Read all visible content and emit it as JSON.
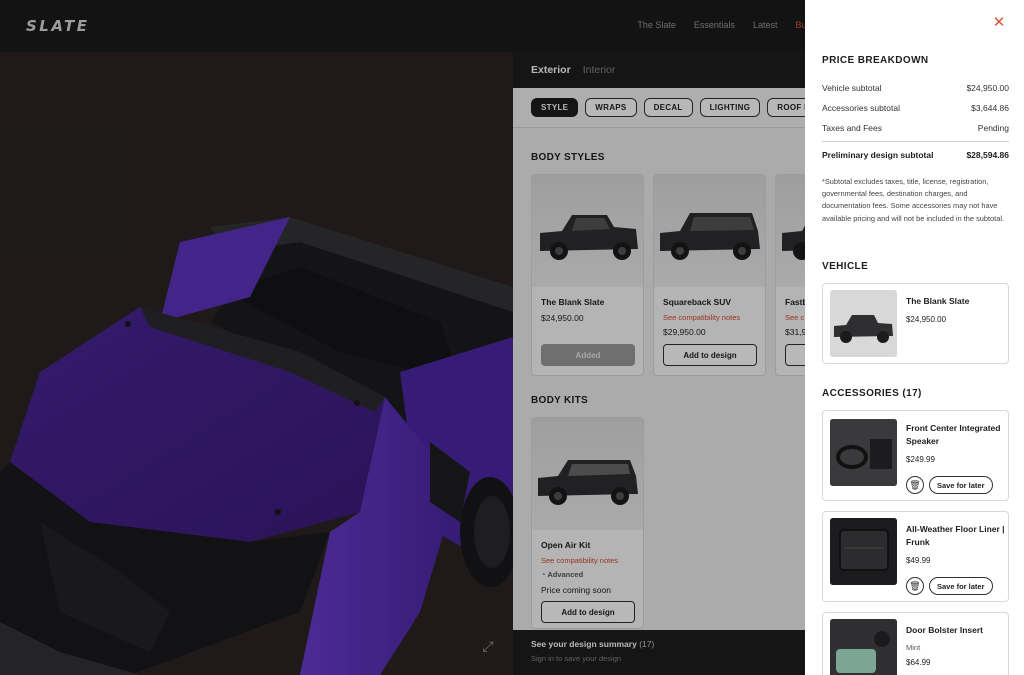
{
  "brand": {
    "logo": "SLATE"
  },
  "nav": {
    "links": [
      "The Slate",
      "Essentials",
      "Latest",
      "Build &"
    ]
  },
  "config": {
    "view_tabs": [
      "Exterior",
      "Interior"
    ],
    "chips": [
      "STYLE",
      "WRAPS",
      "DECAL",
      "LIGHTING",
      "ROOF RACKS"
    ],
    "body_styles_title": "BODY STYLES",
    "body_styles": [
      {
        "name": "The Blank Slate",
        "price": "$24,950.00",
        "button": "Added"
      },
      {
        "name": "Squareback SUV",
        "note": "See compatibility notes",
        "price": "$29,950.00",
        "button": "Add to design"
      },
      {
        "name": "Fastb",
        "note": "See c",
        "price": "$31,9"
      }
    ],
    "body_kits_title": "BODY KITS",
    "body_kits": [
      {
        "name": "Open Air Kit",
        "note": "See compatibility notes",
        "tag": "Advanced",
        "price": "Price coming soon",
        "button": "Add to design"
      }
    ],
    "summary": {
      "title": "See your design summary",
      "count": "(17)",
      "subtitle": "Sign in to save your design"
    }
  },
  "drawer": {
    "price_title": "PRICE BREAKDOWN",
    "rows": [
      {
        "label": "Vehicle subtotal",
        "value": "$24,950.00"
      },
      {
        "label": "Accessories subtotal",
        "value": "$3,644.86"
      },
      {
        "label": "Taxes and Fees",
        "value": "Pending"
      }
    ],
    "total": {
      "label": "Preliminary design subtotal",
      "value": "$28,594.86"
    },
    "disclaimer": "*Subtotal excludes taxes, title, license, registration, governmental fees, destination charges, and documentation fees. Some accessories may not have available pricing and will not be included in the subtotal.",
    "vehicle_title": "VEHICLE",
    "vehicle": {
      "name": "The Blank Slate",
      "price": "$24,950.00"
    },
    "accessories_title": "ACCESSORIES (17)",
    "accessories": [
      {
        "name": "Front Center Integrated Speaker",
        "price": "$249.99",
        "save": "Save for later"
      },
      {
        "name": "All-Weather Floor Liner | Frunk",
        "price": "$49.99",
        "save": "Save for later"
      },
      {
        "name": "Door Bolster Insert",
        "variant": "Mint",
        "price": "$64.99"
      }
    ]
  },
  "colors": {
    "accent": "#e0553a",
    "truck_purple": "#5a2fb0",
    "dark": "#1e1e1e"
  }
}
